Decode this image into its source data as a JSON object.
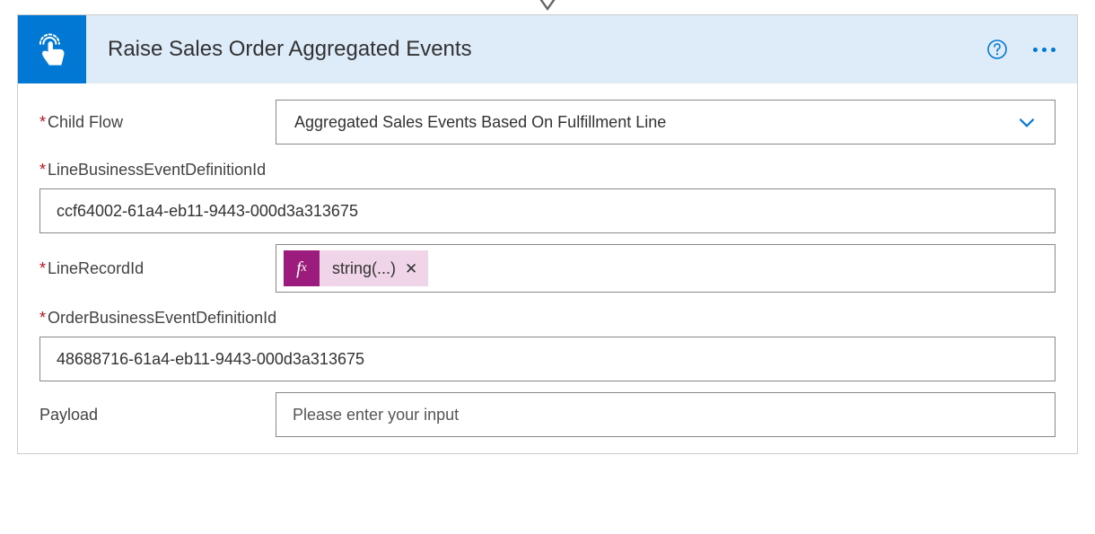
{
  "header": {
    "title": "Raise Sales Order Aggregated Events"
  },
  "fields": {
    "childFlow": {
      "label": "Child Flow",
      "value": "Aggregated Sales Events Based On Fulfillment Line",
      "required": true
    },
    "lineBusinessEventDefinitionId": {
      "label": "LineBusinessEventDefinitionId",
      "value": "ccf64002-61a4-eb11-9443-000d3a313675",
      "required": true
    },
    "lineRecordId": {
      "label": "LineRecordId",
      "expression": "string(...)",
      "required": true
    },
    "orderBusinessEventDefinitionId": {
      "label": "OrderBusinessEventDefinitionId",
      "value": "48688716-61a4-eb11-9443-000d3a313675",
      "required": true
    },
    "payload": {
      "label": "Payload",
      "placeholder": "Please enter your input",
      "required": false
    }
  },
  "icons": {
    "fx": "fx"
  }
}
